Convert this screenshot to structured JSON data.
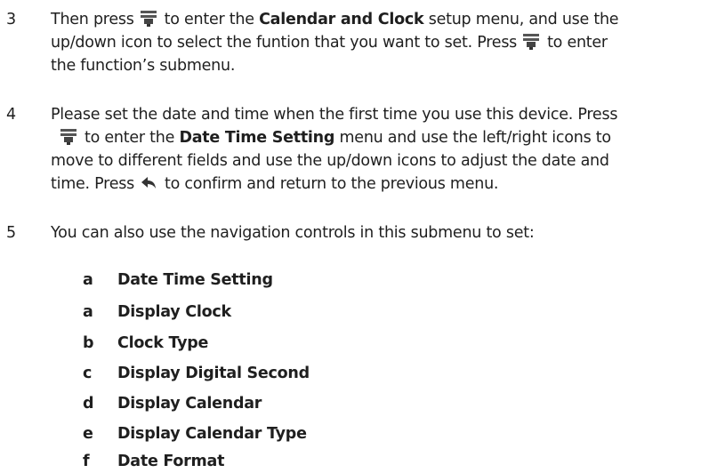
{
  "steps": [
    {
      "number": "3",
      "l1a": "Then press",
      "l1b": "to enter the",
      "l1bold": "Calendar and Clock",
      "l1c": "setup menu, and use the",
      "l2a": "up/down icon to select the funtion that you want to set. Press",
      "l2b": "to enter",
      "l3a": "the function’s submenu."
    },
    {
      "number": "4",
      "l1a": "Please set the date and time when the first time you use this device. Press",
      "l2b": "to enter the",
      "l2bold": "Date Time Setting",
      "l2c": "menu and use the left/right icons to",
      "l3a": "move to different fields and use the up/down icons  to adjust the date and",
      "l4a": "time. Press",
      "l4b": "to confirm and return to the previous menu."
    },
    {
      "number": "5",
      "l1a": "You can also use the navigation controls in this submenu to set:"
    }
  ],
  "submenu": [
    {
      "letter": "a",
      "label": "Date Time Setting"
    },
    {
      "letter": "a",
      "label": "Display Clock"
    },
    {
      "letter": "b",
      "label": "Clock Type"
    },
    {
      "letter": "c",
      "label": "Display Digital Second"
    },
    {
      "letter": "d",
      "label": "Display Calendar"
    },
    {
      "letter": "e",
      "label": "Display Calendar Type"
    },
    {
      "letter": "f",
      "label": "Date Format"
    }
  ],
  "icons": {
    "enter": "enter-icon",
    "back": "back-icon"
  }
}
